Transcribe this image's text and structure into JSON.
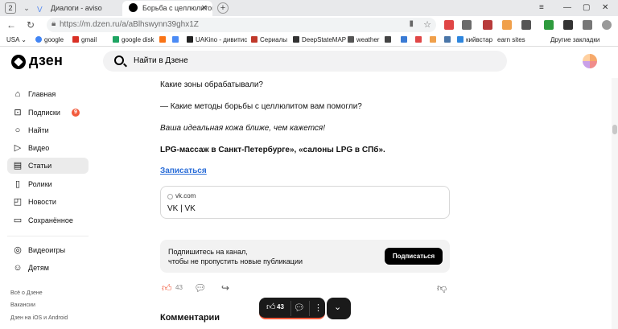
{
  "browser": {
    "tab_counter": "2",
    "tabs": [
      {
        "title": "Диалоги - aviso"
      },
      {
        "title": "Борьба с целлюлитом"
      }
    ],
    "url": "https://m.dzen.ru/a/aBlhswynn39ghx1Z",
    "bookmarks": [
      {
        "label": "USA",
        "color": "#6a6a6a"
      },
      {
        "label": "google",
        "color": "#4285f4"
      },
      {
        "label": "gmail",
        "color": "#d93025"
      },
      {
        "label": "google disk",
        "color": "#1fa463"
      },
      {
        "label": "",
        "color": "#f97316"
      },
      {
        "label": "",
        "color": "#4b8bf5"
      },
      {
        "label": "UAKino - дивитис",
        "color": "#222222"
      },
      {
        "label": "Сериалы",
        "color": "#c0392b"
      },
      {
        "label": "DeepStateMAP",
        "color": "#333333"
      },
      {
        "label": "weather",
        "color": "#555555"
      },
      {
        "label": "кийвстар",
        "color": "#2e86de"
      },
      {
        "label": "earn sites",
        "color": "#999999"
      },
      {
        "label": "Другие закладки",
        "color": "#777777"
      }
    ]
  },
  "header": {
    "logo": "дзен",
    "search_placeholder": "Найти в Дзене"
  },
  "sidebar": {
    "items": [
      {
        "label": "Главная",
        "icon": "home-icon",
        "glyph": "⌂"
      },
      {
        "label": "Подписки",
        "icon": "subscriptions-icon",
        "glyph": "⊡",
        "badge": "9"
      },
      {
        "label": "Найти",
        "icon": "search-icon",
        "glyph": "○"
      },
      {
        "label": "Видео",
        "icon": "video-icon",
        "glyph": "▷"
      },
      {
        "label": "Статьи",
        "icon": "articles-icon",
        "glyph": "▤"
      },
      {
        "label": "Ролики",
        "icon": "shorts-icon",
        "glyph": "▯"
      },
      {
        "label": "Новости",
        "icon": "news-icon",
        "glyph": "◰"
      },
      {
        "label": "Сохранённое",
        "icon": "bookmark-icon",
        "glyph": "▭"
      },
      {
        "label": "Видеоигры",
        "icon": "gamepad-icon",
        "glyph": "◎"
      },
      {
        "label": "Детям",
        "icon": "kids-icon",
        "glyph": "☺"
      }
    ],
    "footer": [
      "Всё о Дзене",
      "Вакансии",
      "Дзен на iOS и Android"
    ]
  },
  "article": {
    "lines": [
      "Какие зоны обрабатывали?",
      "— Какие методы борьбы с целлюлитом вам помогли?",
      "Ваша идеальная кожа ближе, чем кажется!",
      "LPG-массаж в Санкт-Петербурге», «салоны LPG в СПб»."
    ],
    "subscribe_link": "Записаться",
    "card": {
      "domain": "vk.com",
      "title": "VK | VK"
    },
    "promo": {
      "line1": "Подпишитесь на канал,",
      "line2": "чтобы не пропустить новые публикации",
      "button": "Подписаться"
    },
    "likes": "43",
    "comments_title": "Комментарии"
  },
  "floatbar": {
    "likes": "43"
  },
  "colors": {
    "accent": "#f25a3c",
    "link": "#2a6dd8"
  }
}
